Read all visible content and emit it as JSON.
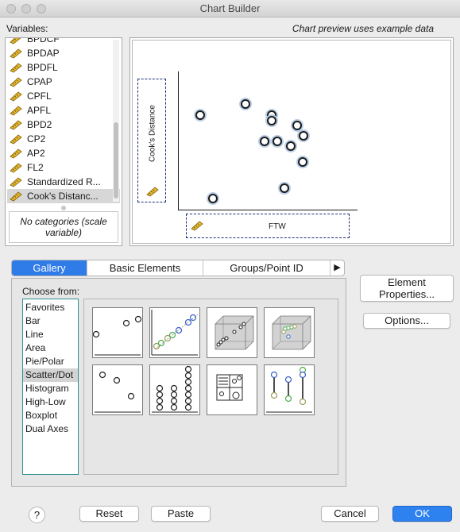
{
  "window": {
    "title": "Chart Builder"
  },
  "variables_label": "Variables:",
  "preview_label": "Chart preview uses example data",
  "variables": [
    "BPDCF",
    "BPDAP",
    "BPDFL",
    "CPAP",
    "CPFL",
    "APFL",
    "BPD2",
    "CP2",
    "AP2",
    "FL2",
    "Standardized R...",
    "Cook's Distanc..."
  ],
  "selected_variable": "Cook's Distanc...",
  "categories_note": "No categories (scale variable)",
  "preview": {
    "y_drop": "Cook's Distance",
    "x_drop": "FTW"
  },
  "tabs": [
    "Gallery",
    "Basic Elements",
    "Groups/Point ID"
  ],
  "active_tab": "Gallery",
  "tab_more": "▶",
  "choose_from_label": "Choose from:",
  "chart_types": [
    "Favorites",
    "Bar",
    "Line",
    "Area",
    "Pie/Polar",
    "Scatter/Dot",
    "Histogram",
    "High-Low",
    "Boxplot",
    "Dual Axes"
  ],
  "selected_chart_type": "Scatter/Dot",
  "buttons": {
    "element_properties": "Element Properties...",
    "options": "Options...",
    "help": "?",
    "reset": "Reset",
    "paste": "Paste",
    "cancel": "Cancel",
    "ok": "OK"
  },
  "icons": {
    "variable": "scale-ruler-icon",
    "gallery": [
      "simple-scatter-icon",
      "grouped-scatter-icon",
      "simple-3d-scatter-icon",
      "grouped-3d-scatter-icon",
      "summary-point-plot-icon",
      "simple-dot-plot-icon",
      "scatterplot-matrix-icon",
      "drop-line-icon"
    ]
  },
  "colors": {
    "accent": "#2f7be8",
    "ok_button": "#2d82f0",
    "drop_zone_border": "#1f2d7a",
    "ruler": "#d4a017",
    "point_halo": "#b9cde5"
  }
}
